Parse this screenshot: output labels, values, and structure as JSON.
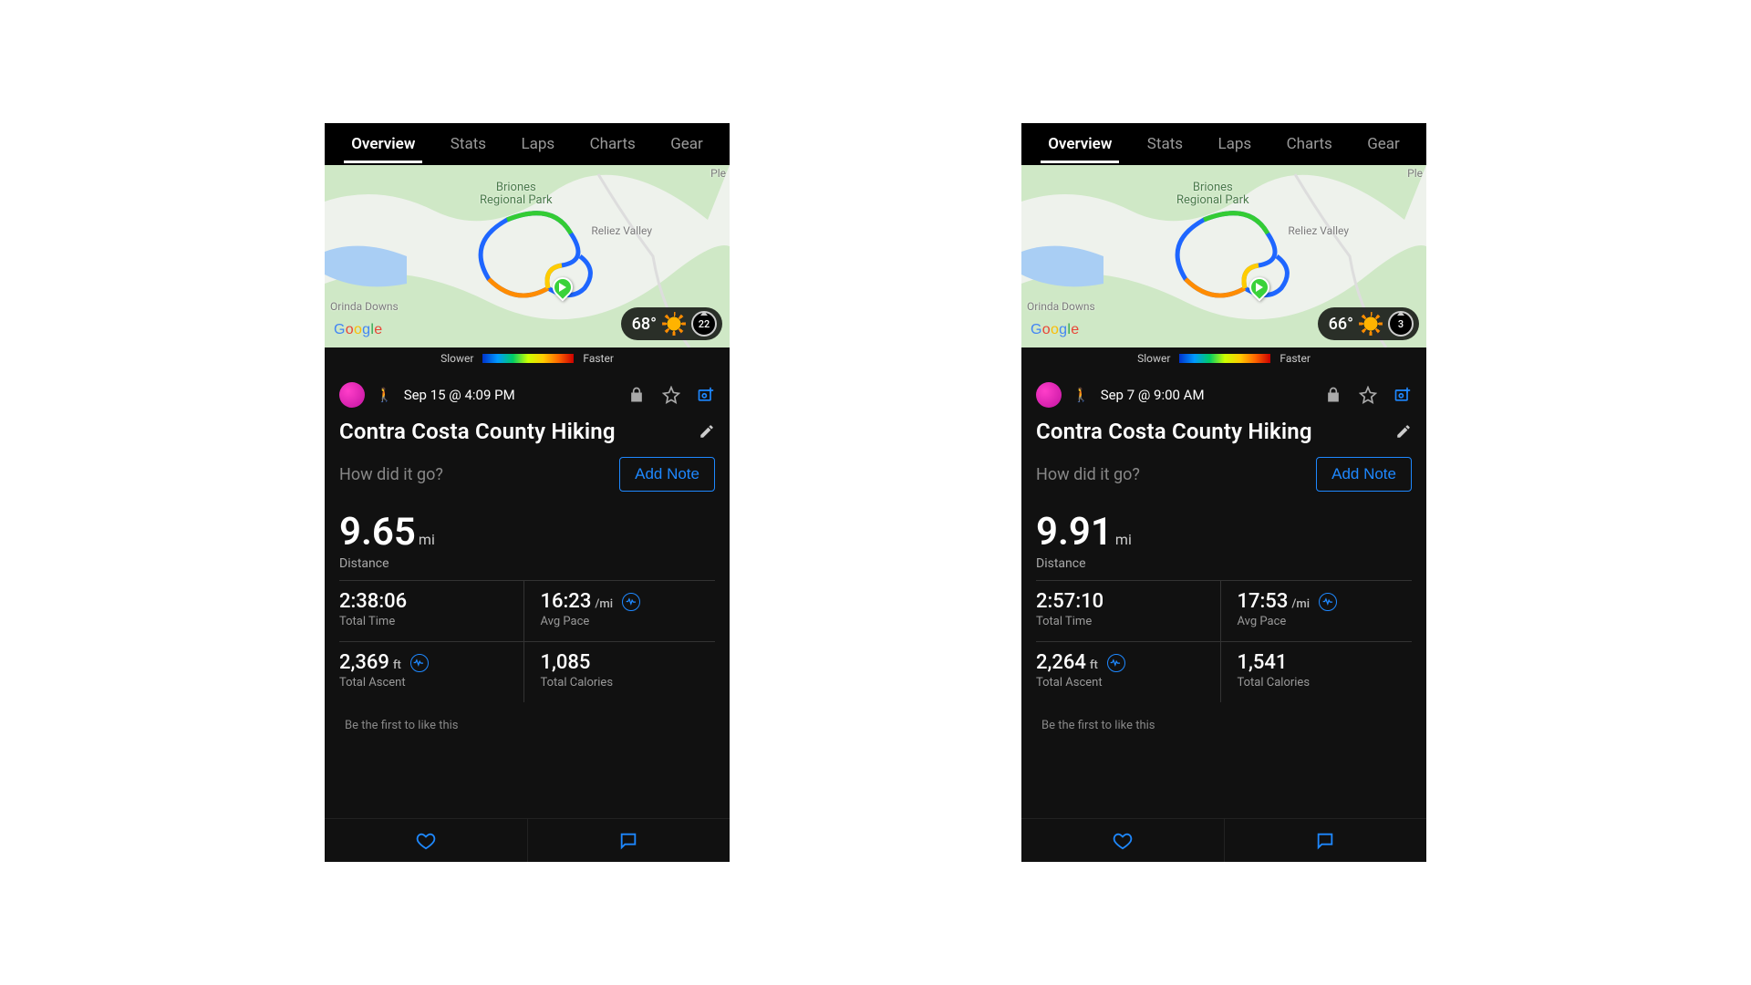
{
  "tabs": [
    "Overview",
    "Stats",
    "Laps",
    "Charts",
    "Gear"
  ],
  "active_tab": "Overview",
  "speed_legend": {
    "slower": "Slower",
    "faster": "Faster"
  },
  "map": {
    "park_label": "Briones\nRegional Park",
    "label_right": "Reliez Valley",
    "label_left": "Orinda Downs",
    "label_far_right": "Ple",
    "logo": "Google"
  },
  "activities": [
    {
      "timestamp": "Sep 15 @ 4:09 PM",
      "title": "Contra Costa County Hiking",
      "prompt": "How did it go?",
      "add_note": "Add Note",
      "weather": {
        "temp": "68°",
        "wind": "22"
      },
      "distance": {
        "value": "9.65",
        "unit": "mi",
        "label": "Distance"
      },
      "stats": {
        "total_time": {
          "value": "2:38:06",
          "label": "Total Time"
        },
        "avg_pace": {
          "value": "16:23",
          "unit": "/mi",
          "label": "Avg Pace"
        },
        "ascent": {
          "value": "2,369",
          "unit": "ft",
          "label": "Total Ascent"
        },
        "calories": {
          "value": "1,085",
          "label": "Total Calories"
        }
      },
      "like_prompt": "Be the first to like this"
    },
    {
      "timestamp": "Sep 7 @ 9:00 AM",
      "title": "Contra Costa County Hiking",
      "prompt": "How did it go?",
      "add_note": "Add Note",
      "weather": {
        "temp": "66°",
        "wind": "3"
      },
      "distance": {
        "value": "9.91",
        "unit": "mi",
        "label": "Distance"
      },
      "stats": {
        "total_time": {
          "value": "2:57:10",
          "label": "Total Time"
        },
        "avg_pace": {
          "value": "17:53",
          "unit": "/mi",
          "label": "Avg Pace"
        },
        "ascent": {
          "value": "2,264",
          "unit": "ft",
          "label": "Total Ascent"
        },
        "calories": {
          "value": "1,541",
          "label": "Total Calories"
        }
      },
      "like_prompt": "Be the first to like this"
    }
  ]
}
